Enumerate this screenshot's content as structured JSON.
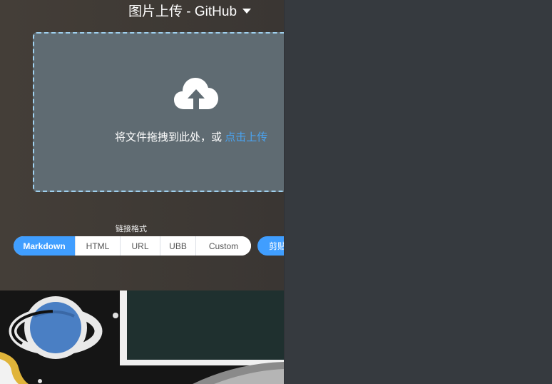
{
  "window": {
    "title": "图片上传 - GitHub"
  },
  "dropzone": {
    "text": "将文件拖拽到此处，或",
    "link": "点击上传"
  },
  "link_format": {
    "label": "链接格式",
    "options": [
      "Markdown",
      "HTML",
      "URL",
      "UBB",
      "Custom"
    ],
    "selected": "Markdown"
  },
  "actions": {
    "copy_label": "剪贴"
  },
  "icons": {
    "upload": "cloud-upload-icon",
    "dropdown": "caret-down-icon",
    "wallpaper": "planet-icon"
  },
  "colors": {
    "accent": "#409eff",
    "link": "#4aa3f0",
    "dropzone_bg": "#5f6b72",
    "dropzone_border": "#9fd0ee",
    "panel_bg": "#363a3f"
  }
}
